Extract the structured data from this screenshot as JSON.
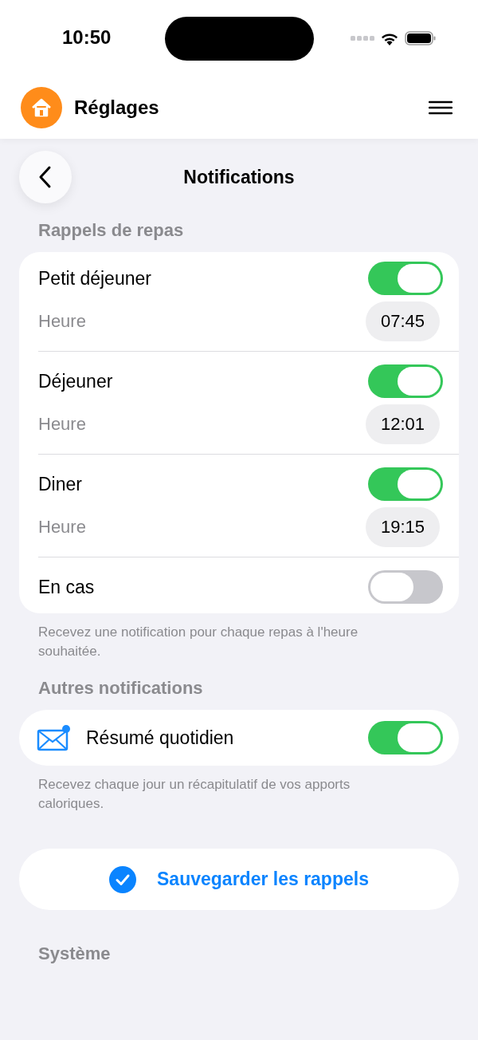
{
  "status_bar": {
    "time": "10:50"
  },
  "app_header": {
    "title": "Réglages"
  },
  "page": {
    "title": "Notifications"
  },
  "sections": [
    {
      "kind": "meals",
      "title": "Rappels de repas",
      "items": [
        {
          "kind": "timed",
          "label": "Petit déjeuner",
          "on": true,
          "time_label": "Heure",
          "time": "07:45"
        },
        {
          "kind": "timed",
          "label": "Déjeuner",
          "on": true,
          "time_label": "Heure",
          "time": "12:01"
        },
        {
          "kind": "timed",
          "label": "Diner",
          "on": true,
          "time_label": "Heure",
          "time": "19:15"
        },
        {
          "kind": "plain",
          "label": "En cas",
          "on": false
        }
      ],
      "footer": "Recevez une notification pour chaque repas à l'heure souhaitée."
    },
    {
      "kind": "other",
      "title": "Autres notifications",
      "items": [
        {
          "kind": "mail",
          "label": "Résumé quotidien",
          "on": true
        }
      ],
      "footer": "Recevez chaque jour un récapitulatif de vos apports caloriques."
    }
  ],
  "save_button": {
    "label": "Sauvegarder les rappels"
  },
  "next_section": {
    "title": "Système"
  }
}
